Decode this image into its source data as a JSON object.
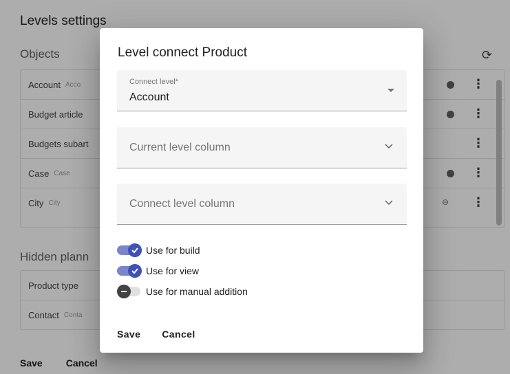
{
  "page": {
    "title": "Levels settings",
    "objects_heading": "Objects",
    "hidden_heading": "Hidden plann",
    "objects": [
      {
        "name": "Account",
        "sub": "Acco"
      },
      {
        "name": "Budget article",
        "sub": ""
      },
      {
        "name": "Budgets subart",
        "sub": ""
      },
      {
        "name": "Case",
        "sub": "Case"
      },
      {
        "name": "City",
        "sub": "City"
      }
    ],
    "hidden": [
      {
        "name": "Product type",
        "sub": ""
      },
      {
        "name": "Contact",
        "sub": "Conta"
      }
    ],
    "save_label": "Save",
    "cancel_label": "Cancel"
  },
  "dialog": {
    "title": "Level connect Product",
    "connect_level": {
      "label": "Connect level*",
      "value": "Account"
    },
    "current_level_column": {
      "placeholder": "Current level column"
    },
    "connect_level_column": {
      "placeholder": "Connect level column"
    },
    "toggles": [
      {
        "label": "Use for build",
        "checked": true
      },
      {
        "label": "Use for view",
        "checked": true
      },
      {
        "label": "Use for manual addition",
        "checked": false
      }
    ],
    "save_label": "Save",
    "cancel_label": "Cancel"
  },
  "colors": {
    "accent": "#3f51b5",
    "accent_track": "#7986cb",
    "backdrop": "rgba(0,0,0,0.32)"
  }
}
